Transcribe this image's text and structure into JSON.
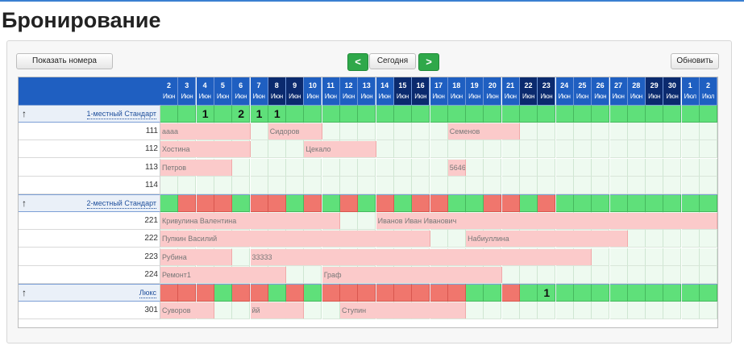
{
  "page": {
    "title": "Бронирование"
  },
  "toolbar": {
    "show_rooms": "Показать номера",
    "prev": "<",
    "today": "Сегодня",
    "next": ">",
    "refresh": "Обновить"
  },
  "days": [
    {
      "day": "2",
      "month": "Июн",
      "dark": false
    },
    {
      "day": "3",
      "month": "Июн",
      "dark": false
    },
    {
      "day": "4",
      "month": "Июн",
      "dark": false
    },
    {
      "day": "5",
      "month": "Июн",
      "dark": false
    },
    {
      "day": "6",
      "month": "Июн",
      "dark": false
    },
    {
      "day": "7",
      "month": "Июн",
      "dark": false
    },
    {
      "day": "8",
      "month": "Июн",
      "dark": true
    },
    {
      "day": "9",
      "month": "Июн",
      "dark": true
    },
    {
      "day": "10",
      "month": "Июн",
      "dark": false
    },
    {
      "day": "11",
      "month": "Июн",
      "dark": false
    },
    {
      "day": "12",
      "month": "Июн",
      "dark": false
    },
    {
      "day": "13",
      "month": "Июн",
      "dark": false
    },
    {
      "day": "14",
      "month": "Июн",
      "dark": false
    },
    {
      "day": "15",
      "month": "Июн",
      "dark": true
    },
    {
      "day": "16",
      "month": "Июн",
      "dark": true
    },
    {
      "day": "17",
      "month": "Июн",
      "dark": false
    },
    {
      "day": "18",
      "month": "Июн",
      "dark": false
    },
    {
      "day": "19",
      "month": "Июн",
      "dark": false
    },
    {
      "day": "20",
      "month": "Июн",
      "dark": false
    },
    {
      "day": "21",
      "month": "Июн",
      "dark": false
    },
    {
      "day": "22",
      "month": "Июн",
      "dark": true
    },
    {
      "day": "23",
      "month": "Июн",
      "dark": true
    },
    {
      "day": "24",
      "month": "Июн",
      "dark": false
    },
    {
      "day": "25",
      "month": "Июн",
      "dark": false
    },
    {
      "day": "26",
      "month": "Июн",
      "dark": false
    },
    {
      "day": "27",
      "month": "Июн",
      "dark": false
    },
    {
      "day": "28",
      "month": "Июн",
      "dark": false
    },
    {
      "day": "29",
      "month": "Июн",
      "dark": true
    },
    {
      "day": "30",
      "month": "Июн",
      "dark": true
    },
    {
      "day": "1",
      "month": "Июл",
      "dark": false
    },
    {
      "day": "2",
      "month": "Июл",
      "dark": false
    }
  ],
  "rows": [
    {
      "type": "category",
      "name": "1-местный Стандарт",
      "cells": "ggggggggggggggggggggggggggggggg",
      "counts": {
        "2": "1",
        "4": "2",
        "5": "1",
        "6": "1"
      }
    },
    {
      "type": "room",
      "number": "111",
      "bookings": [
        {
          "start": 0,
          "len": 5,
          "name": "аааа"
        },
        {
          "start": 6,
          "len": 3,
          "name": "Сидоров"
        },
        {
          "start": 16,
          "len": 4,
          "name": "Семенов"
        }
      ]
    },
    {
      "type": "room",
      "number": "112",
      "bookings": [
        {
          "start": 0,
          "len": 5,
          "name": "Хостина"
        },
        {
          "start": 8,
          "len": 4,
          "name": "Цекало"
        }
      ]
    },
    {
      "type": "room",
      "number": "113",
      "bookings": [
        {
          "start": 0,
          "len": 4,
          "name": "Петров"
        },
        {
          "start": 16,
          "len": 1,
          "name": "5646"
        }
      ]
    },
    {
      "type": "room",
      "number": "114",
      "bookings": []
    },
    {
      "type": "category",
      "name": "2-местный Стандарт",
      "cells": "grrrgrrgrgrgrgrrggrrgrgggggggggg",
      "counts": {}
    },
    {
      "type": "room",
      "number": "221",
      "bookings": [
        {
          "start": 0,
          "len": 10,
          "name": "Кривулина Валентина"
        },
        {
          "start": 12,
          "len": 19,
          "name": "Иванов Иван Иванович"
        }
      ]
    },
    {
      "type": "room",
      "number": "222",
      "bookings": [
        {
          "start": 0,
          "len": 15,
          "name": "Пупкин Василий"
        },
        {
          "start": 17,
          "len": 9,
          "name": "Набиуллина"
        }
      ]
    },
    {
      "type": "room",
      "number": "223",
      "bookings": [
        {
          "start": 0,
          "len": 4,
          "name": "Рубина"
        },
        {
          "start": 5,
          "len": 19,
          "name": "33333"
        }
      ]
    },
    {
      "type": "room",
      "number": "224",
      "bookings": [
        {
          "start": 0,
          "len": 7,
          "name": "Ремонт1"
        },
        {
          "start": 9,
          "len": 10,
          "name": "Граф"
        }
      ]
    },
    {
      "type": "category",
      "name": "Люкс",
      "cells": "rrrgrrgrgrrrrrrrrggrggggggggggg",
      "counts": {
        "21": "1"
      }
    },
    {
      "type": "room",
      "number": "301",
      "bookings": [
        {
          "start": 0,
          "len": 3,
          "name": "Суворов"
        },
        {
          "start": 5,
          "len": 3,
          "name": "йй"
        },
        {
          "start": 10,
          "len": 7,
          "name": "Ступин"
        }
      ]
    }
  ],
  "colors": {
    "header_blue": "#1f5fc1",
    "header_dark": "#0b2a6e",
    "free": "#5fe07a",
    "busy": "#f0766d",
    "booking": "#fbcaca",
    "nav_green": "#2fa84a"
  }
}
